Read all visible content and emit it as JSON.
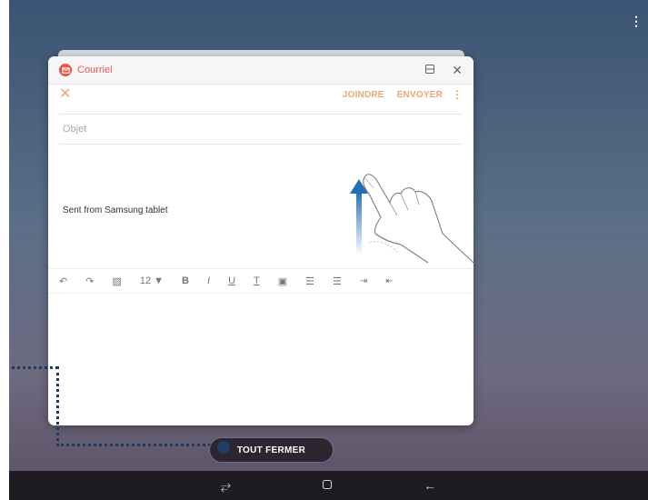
{
  "window": {
    "app_title": "Courriel",
    "app_icon": "email-icon",
    "icons": [
      "split-view-icon",
      "close-icon"
    ]
  },
  "compose": {
    "close_icon": "close-icon",
    "attach_label": "JOINDRE",
    "send_label": "ENVOYER",
    "more_icon": "more-vertical-icon",
    "subject_placeholder": "Objet",
    "signature": "Sent from Samsung tablet"
  },
  "toolbar": {
    "font_size": "12",
    "items": [
      "undo-icon",
      "redo-icon",
      "insert-image-icon",
      "font-size-dropdown",
      "bold-icon",
      "italic-icon",
      "underline-icon",
      "text-color-icon",
      "highlight-icon",
      "numbered-list-icon",
      "bulleted-list-icon",
      "indent-icon",
      "outdent-icon"
    ]
  },
  "recents": {
    "close_all_label": "TOUT FERMER"
  },
  "navbar": {
    "icons": [
      "recents-icon",
      "home-icon",
      "back-icon"
    ]
  },
  "colors": {
    "accent": "#f0a577",
    "app_red": "#e8574f",
    "callout": "#1c3a63"
  }
}
